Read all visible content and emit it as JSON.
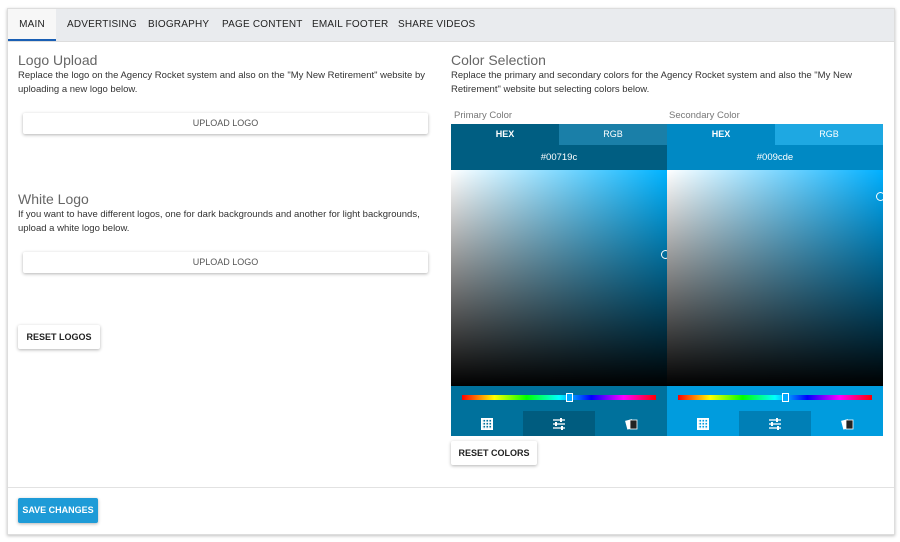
{
  "tabs": [
    {
      "label": "MAIN"
    },
    {
      "label": "ADVERTISING"
    },
    {
      "label": "BIOGRAPHY"
    },
    {
      "label": "PAGE CONTENT"
    },
    {
      "label": "EMAIL FOOTER"
    },
    {
      "label": "SHARE VIDEOS"
    }
  ],
  "logo_upload": {
    "title": "Logo Upload",
    "description_line1": "Replace the logo on the Agency Rocket system and also on the \"My New Retirement\" website by",
    "description_line2": "uploading a new logo below.",
    "button_label": "UPLOAD LOGO"
  },
  "white_logo": {
    "title": "White Logo",
    "description_line1": "If you want to have different logos, one for dark backgrounds and another for light backgrounds,",
    "description_line2": "upload a white logo below.",
    "button_label": "UPLOAD LOGO"
  },
  "reset_logos_label": "RESET LOGOS",
  "color_selection": {
    "title": "Color Selection",
    "description_line1": "Replace the primary and secondary colors for the Agency Rocket system and also the \"My New",
    "description_line2": "Retirement\" website but selecting colors below."
  },
  "primary": {
    "label": "Primary Color",
    "hex_tab": "HEX",
    "rgb_tab": "RGB",
    "value": "#00719c",
    "color": "#00719c",
    "tab_dark": "#005e82",
    "tab_light": "#1a7fa8",
    "field_hue": "#00b3ff",
    "hue_position": 0.55
  },
  "secondary": {
    "label": "Secondary Color",
    "hex_tab": "HEX",
    "rgb_tab": "RGB",
    "value": "#009cde",
    "color": "#009cde",
    "tab_dark": "#0089c4",
    "tab_light": "#1ea8e2",
    "field_hue": "#00b0ff",
    "hue_position": 0.55
  },
  "reset_colors_label": "RESET COLORS",
  "save_label": "SAVE CHANGES",
  "accent_color": "#1e9bd7"
}
